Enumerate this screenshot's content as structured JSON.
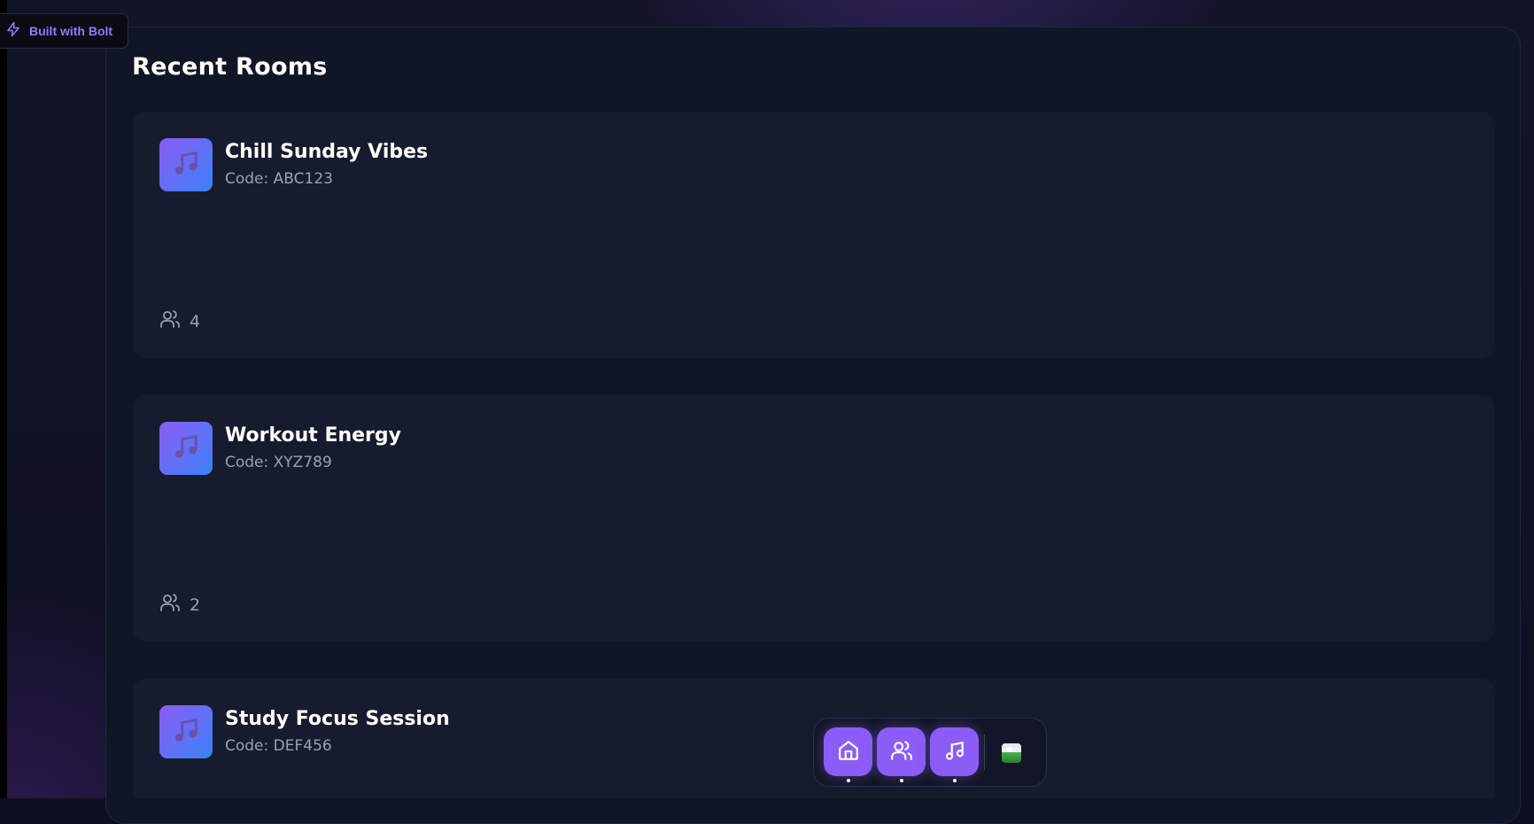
{
  "badge": {
    "label": "Built with Bolt",
    "icon": "bolt-icon"
  },
  "page": {
    "section_title": "Recent Rooms"
  },
  "rooms": [
    {
      "name": "Chill Sunday Vibes",
      "code": "Code: ABC123",
      "members": "4",
      "icon": "music-note-icon"
    },
    {
      "name": "Workout Energy",
      "code": "Code: XYZ789",
      "members": "2",
      "icon": "music-note-icon"
    },
    {
      "name": "Study Focus Session",
      "code": "Code: DEF456",
      "icon": "music-note-icon"
    }
  ],
  "dock": {
    "items": [
      {
        "name": "home",
        "icon": "home-icon"
      },
      {
        "name": "friends",
        "icon": "users-icon"
      },
      {
        "name": "music",
        "icon": "music-icon"
      }
    ],
    "avatar": "user-avatar"
  },
  "colors": {
    "accent": "#8b5cf6",
    "accent_secondary": "#3b82f6",
    "bolt_text": "#8f7cff",
    "card_bg": "#161c2e",
    "panel_bg": "#111626",
    "muted_text": "#9aa1b5"
  }
}
